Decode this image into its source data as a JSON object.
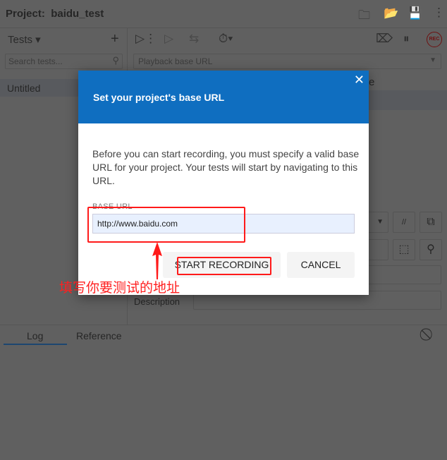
{
  "header": {
    "project_label": "Project:",
    "project_name": "baidu_test"
  },
  "tests": {
    "label": "Tests",
    "search_placeholder": "Search tests...",
    "items": [
      "Untitled"
    ]
  },
  "toolbar": {
    "playback_placeholder": "Playback base URL",
    "rec_label": "REC"
  },
  "editor": {
    "description_label": "Description",
    "partial_header": "e"
  },
  "bottom": {
    "tabs": [
      "Log",
      "Reference"
    ]
  },
  "modal": {
    "title": "Set your project's base URL",
    "description": "Before you can start recording, you must specify a valid base URL for your project. Your tests will start by navigating to this URL.",
    "field_label": "BASE URL",
    "field_value": "http://www.baidu.com",
    "start_label": "START RECORDING",
    "cancel_label": "CANCEL"
  },
  "annotation": {
    "text": "填写你要测试的地址",
    "color": "#ff1a1a"
  },
  "colors": {
    "modal_header": "#0f6ec0",
    "input_bg": "#e8f0fe"
  }
}
